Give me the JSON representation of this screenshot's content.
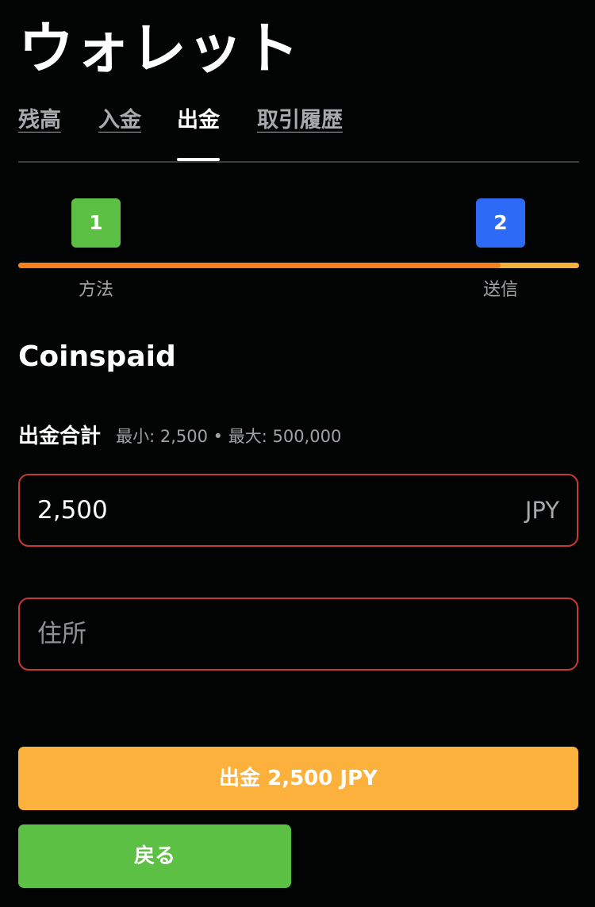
{
  "header": {
    "title": "ウォレット"
  },
  "tabs": [
    {
      "label": "残高",
      "active": false
    },
    {
      "label": "入金",
      "active": false
    },
    {
      "label": "出金",
      "active": true
    },
    {
      "label": "取引履歴",
      "active": false
    }
  ],
  "stepper": {
    "progress_percent": 86,
    "steps": [
      {
        "number": "1",
        "label": "方法",
        "status": "done"
      },
      {
        "number": "2",
        "label": "送信",
        "status": "current"
      }
    ]
  },
  "method": {
    "name": "Coinspaid"
  },
  "amount": {
    "label": "出金合計",
    "limits": "最小: 2,500 • 最大: 500,000",
    "value": "2,500",
    "currency": "JPY"
  },
  "address": {
    "placeholder": "住所",
    "value": ""
  },
  "actions": {
    "withdraw_label": "出金 2,500 JPY",
    "back_label": "戻る"
  },
  "colors": {
    "background": "#020303",
    "step_done": "#5cc045",
    "step_current": "#2d6af6",
    "progress_fill": "#f4801f",
    "progress_track": "#f2b13c",
    "field_border_error": "#c53a34",
    "withdraw_button": "#fbb13c",
    "back_button": "#5cc045"
  }
}
